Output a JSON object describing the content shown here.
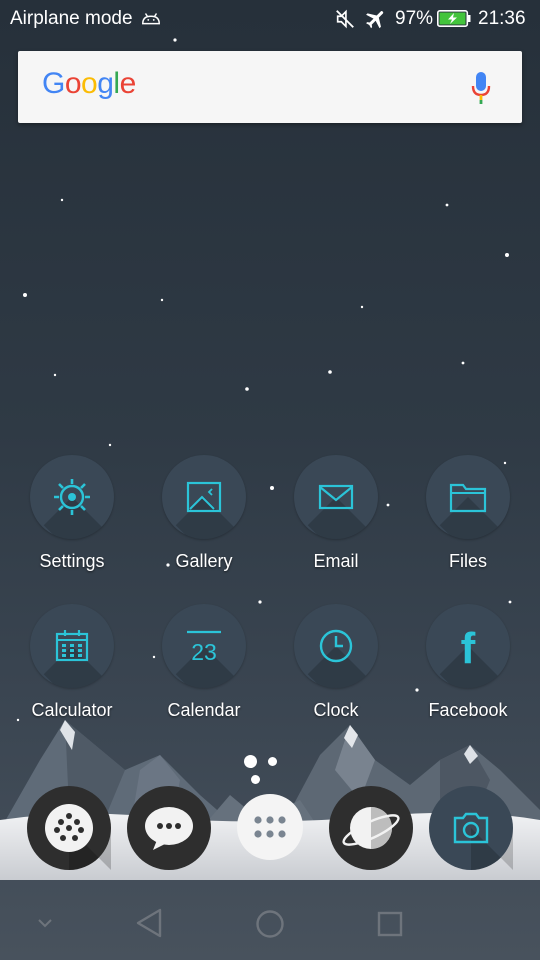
{
  "status_bar": {
    "mode_text": "Airplane mode",
    "battery_percent": "97%",
    "time": "21:36",
    "icons": [
      "android-debug-icon",
      "mute-icon",
      "airplane-icon",
      "battery-charging-icon"
    ]
  },
  "search": {
    "logo_text": "Google",
    "logo_colors": [
      "#4285F4",
      "#EA4335",
      "#FBBC05",
      "#4285F4",
      "#34A853",
      "#EA4335"
    ],
    "mic_icon": "mic-icon"
  },
  "apps_row1": [
    {
      "label": "Settings",
      "icon": "gear-icon"
    },
    {
      "label": "Gallery",
      "icon": "picture-icon"
    },
    {
      "label": "Email",
      "icon": "envelope-icon"
    },
    {
      "label": "Files",
      "icon": "folder-icon"
    }
  ],
  "apps_row2": [
    {
      "label": "Calculator",
      "icon": "calculator-icon"
    },
    {
      "label": "Calendar",
      "icon": "calendar-icon",
      "day": "23"
    },
    {
      "label": "Clock",
      "icon": "clock-icon"
    },
    {
      "label": "Facebook",
      "icon": "facebook-icon",
      "glyph": "f"
    }
  ],
  "page_indicator": {
    "pages": 3,
    "current": 1
  },
  "dock": [
    {
      "name": "dialer",
      "icon": "dialpad-icon"
    },
    {
      "name": "messaging",
      "icon": "chat-bubble-icon"
    },
    {
      "name": "app-drawer",
      "icon": "app-drawer-icon"
    },
    {
      "name": "browser",
      "icon": "planet-icon"
    },
    {
      "name": "camera",
      "icon": "camera-icon"
    }
  ],
  "nav_bar": {
    "icons": [
      "hide-nav-chevron-icon",
      "back-icon",
      "home-icon",
      "recents-icon"
    ]
  },
  "colors": {
    "accent": "#2bc4d8",
    "circle": "#3a4856",
    "dock_dark": "#2e2e2e"
  }
}
